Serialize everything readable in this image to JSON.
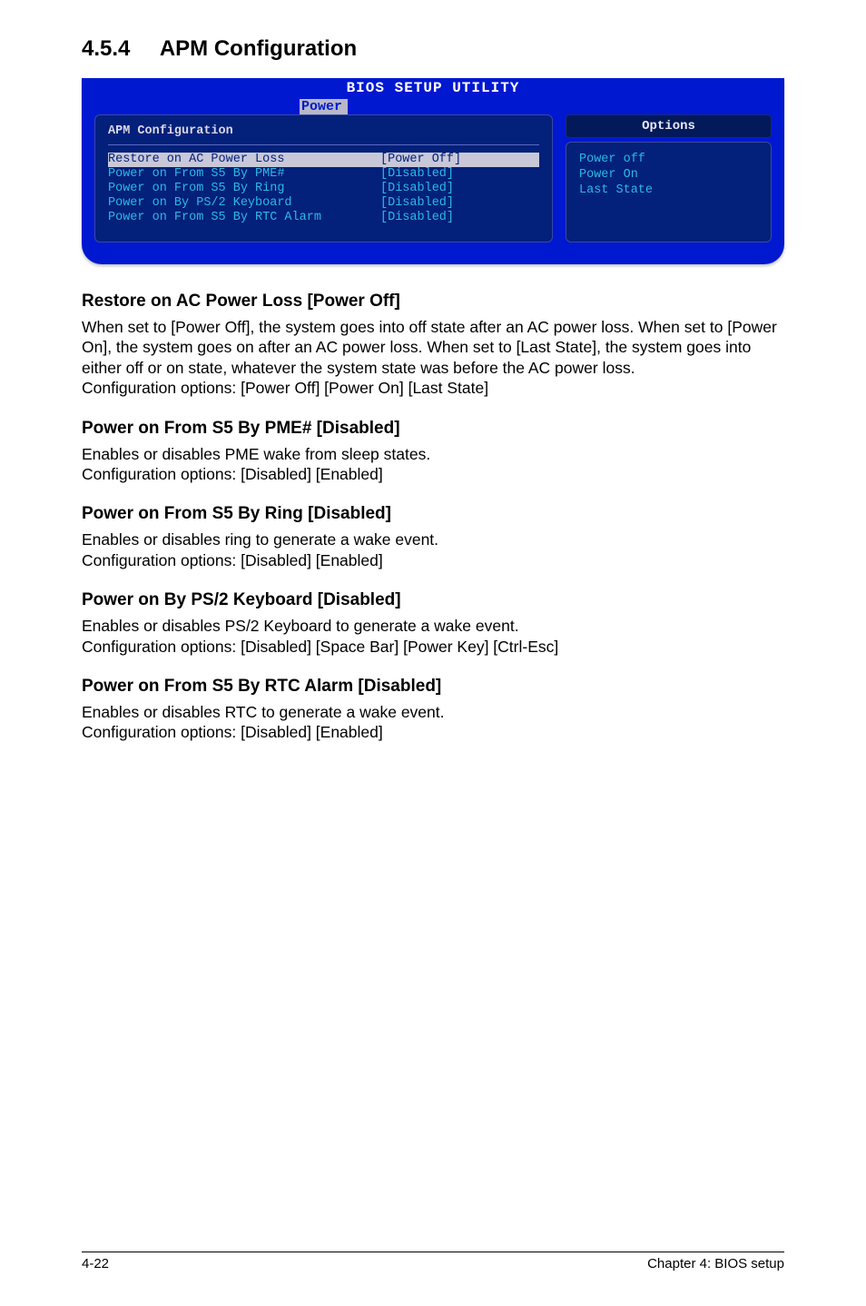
{
  "heading": {
    "number": "4.5.4",
    "title": "APM Configuration"
  },
  "bios": {
    "utility_title": "BIOS SETUP UTILITY",
    "tab_label": "Power",
    "left_title": "APM Configuration",
    "rows": [
      {
        "label": "Restore on AC Power Loss",
        "value": "[Power Off]",
        "selected": true
      },
      {
        "label": "Power on From S5 By PME#",
        "value": "[Disabled]",
        "selected": false
      },
      {
        "label": "Power on From S5 By Ring",
        "value": "[Disabled]",
        "selected": false
      },
      {
        "label": "Power on By PS/2 Keyboard",
        "value": "[Disabled]",
        "selected": false
      },
      {
        "label": "Power on From S5 By RTC Alarm",
        "value": "[Disabled]",
        "selected": false
      }
    ],
    "options_header": "Options",
    "options": [
      "Power off",
      "Power On",
      "Last State"
    ]
  },
  "settings": [
    {
      "title": "Restore on AC Power Loss [Power Off]",
      "desc": "When set to [Power Off], the system goes into off state after an AC power loss. When set to [Power On], the system goes on after an AC power loss. When set to [Last State], the system goes into either off or on state, whatever the system state was before the AC power loss.\nConfiguration options: [Power Off] [Power On] [Last State]"
    },
    {
      "title": "Power on From S5 By PME# [Disabled]",
      "desc": "Enables or disables PME wake from sleep states.\nConfiguration options: [Disabled] [Enabled]"
    },
    {
      "title": "Power on From S5 By Ring [Disabled]",
      "desc": "Enables or disables ring to generate a wake event.\nConfiguration options: [Disabled] [Enabled]"
    },
    {
      "title": "Power on By PS/2 Keyboard [Disabled]",
      "desc": "Enables or disables PS/2 Keyboard to generate a wake event.\nConfiguration options: [Disabled] [Space Bar] [Power Key] [Ctrl-Esc]"
    },
    {
      "title": "Power on From S5 By RTC Alarm [Disabled]",
      "desc": "Enables or disables RTC to generate a wake event.\nConfiguration options: [Disabled] [Enabled]"
    }
  ],
  "footer": {
    "page": "4-22",
    "chapter": "Chapter 4: BIOS setup"
  }
}
